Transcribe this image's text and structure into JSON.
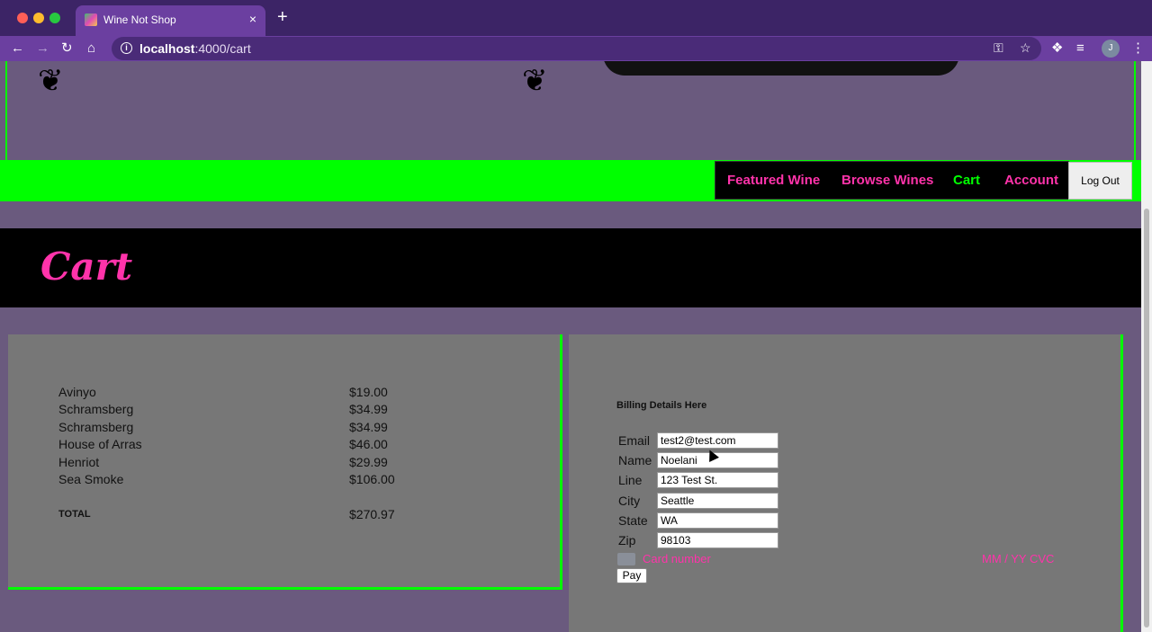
{
  "browser": {
    "tab_title": "Wine Not Shop",
    "tab_close": "×",
    "new_tab": "+",
    "url_host": "localhost",
    "url_path": ":4000/cart",
    "avatar_letter": "J"
  },
  "nav": {
    "links": [
      "Featured Wine",
      "Browse Wines",
      "Cart",
      "Account"
    ],
    "active": "Cart",
    "logout_label": "Log Out"
  },
  "page": {
    "title": "Cart"
  },
  "cart": {
    "items": [
      {
        "name": "Avinyo",
        "price": "$19.00"
      },
      {
        "name": "Schramsberg",
        "price": "$34.99"
      },
      {
        "name": "Schramsberg",
        "price": "$34.99"
      },
      {
        "name": "House of Arras",
        "price": "$46.00"
      },
      {
        "name": "Henriot",
        "price": "$29.99"
      },
      {
        "name": "Sea Smoke",
        "price": "$106.00"
      }
    ],
    "total_label": "TOTAL",
    "total_value": "$270.97"
  },
  "billing": {
    "heading": "Billing Details Here",
    "fields": [
      {
        "label": "Email",
        "value": "test2@test.com"
      },
      {
        "label": "Name",
        "value": "Noelani"
      },
      {
        "label": "Line",
        "value": "123 Test St."
      },
      {
        "label": "City",
        "value": "Seattle"
      },
      {
        "label": "State",
        "value": "WA"
      },
      {
        "label": "Zip",
        "value": "98103"
      }
    ],
    "card_number_placeholder": "Card number",
    "card_exp_cvc_placeholder": "MM / YY  CVC",
    "pay_label": "Pay"
  },
  "colors": {
    "accent_pink": "#ff33aa",
    "accent_green": "#00ff00",
    "page_bg": "#6a5a7e",
    "panel_bg": "#777777"
  }
}
